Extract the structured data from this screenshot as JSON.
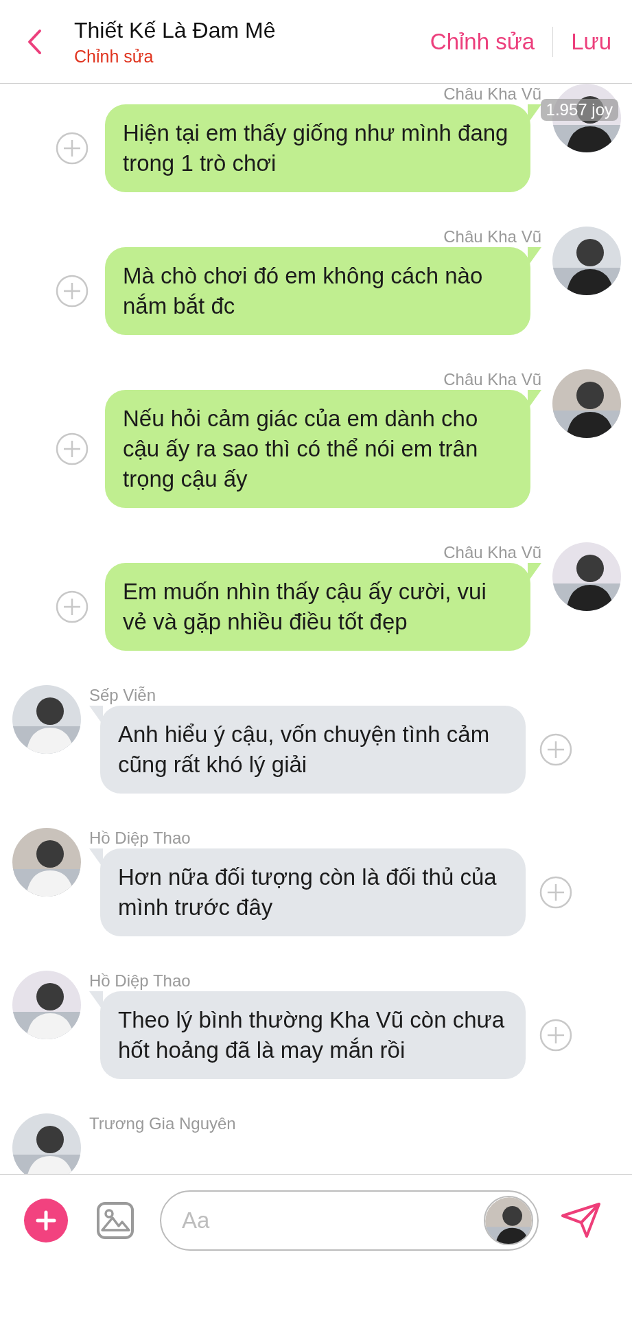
{
  "header": {
    "title": "Thiết Kế Là Đam Mê",
    "subtitle": "Chỉnh sửa",
    "actions": [
      "Chỉnh sửa",
      "Lưu"
    ]
  },
  "messages": [
    {
      "kind": "outgoing",
      "sender": "Châu Kha Vũ",
      "text": "Hiện tại em thấy giống như mình đang trong 1 trò chơi",
      "badge": "1.957 joy"
    },
    {
      "kind": "outgoing",
      "sender": "Châu Kha Vũ",
      "text": "Mà chò chơi đó em không cách nào nắm bắt đc"
    },
    {
      "kind": "outgoing",
      "sender": "Châu Kha Vũ",
      "text": "Nếu hỏi cảm giác của em dành cho cậu ấy ra sao thì có thể nói em trân trọng cậu ấy"
    },
    {
      "kind": "outgoing",
      "sender": "Châu Kha Vũ",
      "text": "Em muốn nhìn thấy cậu ấy cười, vui vẻ và gặp nhiều điều tốt đẹp"
    },
    {
      "kind": "incoming",
      "sender": "Sếp Viễn",
      "text": "Anh hiểu ý cậu, vốn chuyện tình cảm cũng rất khó lý giải"
    },
    {
      "kind": "incoming",
      "sender": "Hồ Diệp Thao",
      "text": "Hơn nữa đối tượng còn là đối thủ của mình trước đây"
    },
    {
      "kind": "incoming",
      "sender": "Hồ Diệp Thao",
      "text": "Theo lý bình thường Kha Vũ còn chưa hốt hoảng đã là may mắn  rồi"
    },
    {
      "kind": "incoming",
      "sender": "Trương Gia Nguyên"
    }
  ],
  "composer": {
    "placeholder": "Aa"
  }
}
